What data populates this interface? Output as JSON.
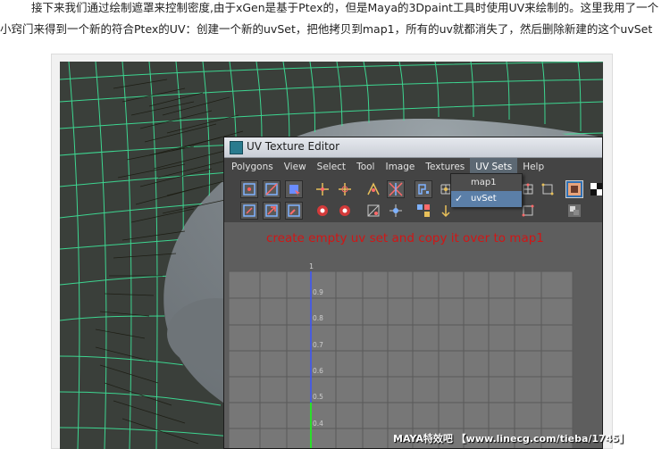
{
  "article": {
    "line1": "接下来我们通过绘制遮罩来控制密度,由于xGen是基于Ptex的，但是Maya的3Dpaint工具时使用UV来绘制的。这里我用了一个",
    "line2": "小窍门来得到一个新的符合Ptex的UV：创建一个新的uvSet，把他拷贝到map1，所有的uv就都消失了，然后删除新建的这个uvSet"
  },
  "uv_editor": {
    "title": "UV Texture Editor",
    "menu": [
      "Polygons",
      "View",
      "Select",
      "Tool",
      "Image",
      "Textures",
      "UV Sets",
      "Help"
    ],
    "active_menu": "UV Sets",
    "uvsets_dropdown": {
      "items": [
        "map1",
        "uvSet"
      ],
      "selected": "uvSet"
    },
    "annotation": "create empty uv set and copy it over to map1",
    "grid_top_label": "1",
    "v_axis_labels": [
      "0.9",
      "0.8",
      "0.7",
      "0.6",
      "0.5",
      "0.4"
    ]
  },
  "colors": {
    "annotation": "#d01616",
    "wireframe": "#3ef0a0",
    "uv_axis": "#3a54ff",
    "uv_axis_green": "#2adf2a",
    "menu_highlight": "#5b7fa8"
  },
  "icons": {
    "toolbar_row1": [
      "select-uv-icon",
      "select-edge-icon",
      "select-face-icon",
      "move-uv-icon",
      "rotate-uv-icon",
      "flip-uv-icon",
      "mirror-uv-icon",
      "layout-uv-icon",
      "cut-uv-icon",
      "grid-uv-icon",
      "snapshot-icon",
      "checker-icon"
    ],
    "toolbar_row2": [
      "unfold-icon",
      "relax-icon",
      "smudge-icon",
      "red-circle-icon",
      "red-circle2-icon",
      "lattice-icon",
      "pin-icon",
      "arrange-icon",
      "shell-icon",
      "texture-borders-icon",
      "image-icon"
    ]
  },
  "watermark": "MAYA特效吧 【www.linecg.com/tieba/1745】"
}
